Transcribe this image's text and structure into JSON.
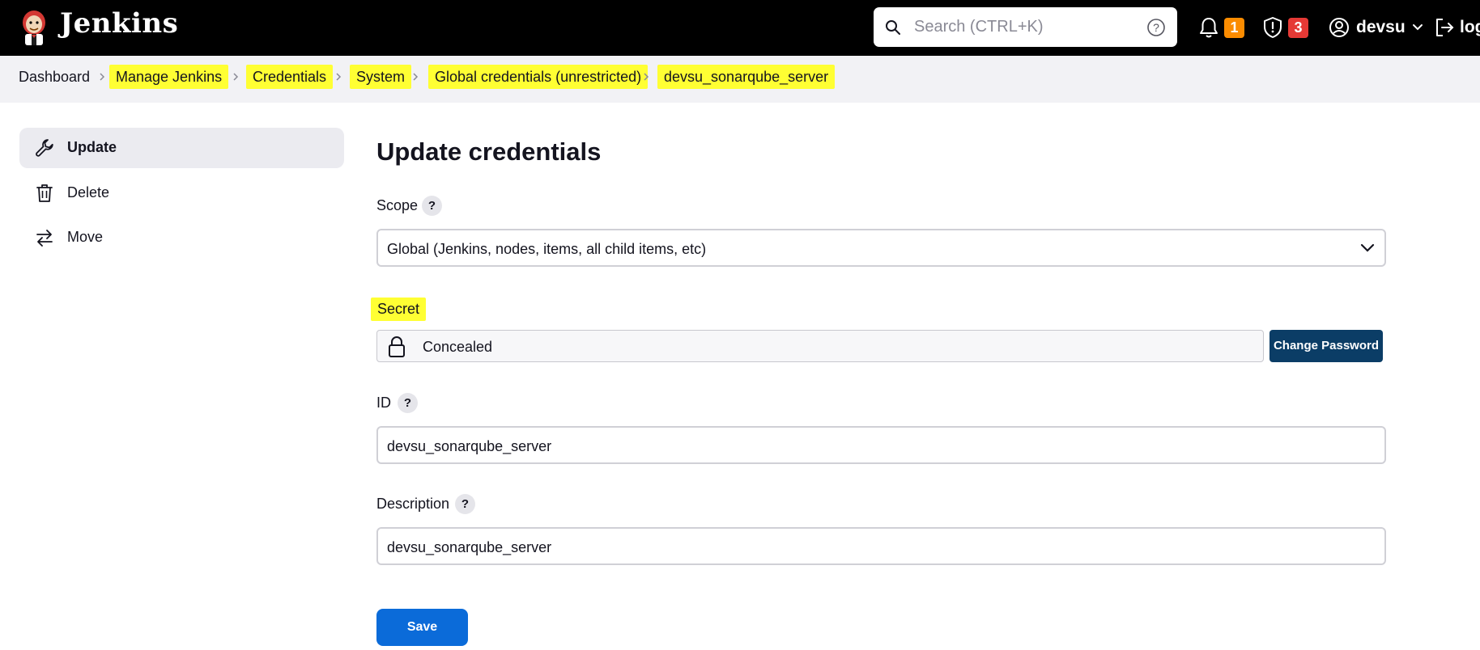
{
  "app": {
    "brand": "Jenkins"
  },
  "header": {
    "search_placeholder": "Search (CTRL+K)",
    "notifications_count": "1",
    "security_count": "3",
    "user_name": "devsu",
    "logout_label": "log"
  },
  "breadcrumb": {
    "items": [
      {
        "label": "Dashboard",
        "highlighted": false
      },
      {
        "label": "Manage Jenkins",
        "highlighted": true
      },
      {
        "label": "Credentials",
        "highlighted": true
      },
      {
        "label": "System",
        "highlighted": true
      },
      {
        "label": "Global credentials (unrestricted)",
        "highlighted": true
      },
      {
        "label": "devsu_sonarqube_server",
        "highlighted": true
      }
    ]
  },
  "sidebar": {
    "items": [
      {
        "label": "Update",
        "icon": "wrench-icon",
        "active": true
      },
      {
        "label": "Delete",
        "icon": "trash-icon",
        "active": false
      },
      {
        "label": "Move",
        "icon": "move-arrows-icon",
        "active": false
      }
    ]
  },
  "form": {
    "title": "Update credentials",
    "scope_label": "Scope",
    "scope_value": "Global (Jenkins, nodes, items, all child items, etc)",
    "secret_label": "Secret",
    "secret_value": "Concealed",
    "change_password_label": "Change Password",
    "id_label": "ID",
    "id_value": "devsu_sonarqube_server",
    "description_label": "Description",
    "description_value": "devsu_sonarqube_server",
    "help_mark": "?",
    "save_label": "Save"
  },
  "colors": {
    "header_bg": "#000000",
    "highlight": "#ffff33",
    "save_button": "#0b6bd9",
    "change_password_button": "#0b3d66",
    "notification_badge": "#fb8c00",
    "security_badge": "#e53935"
  }
}
